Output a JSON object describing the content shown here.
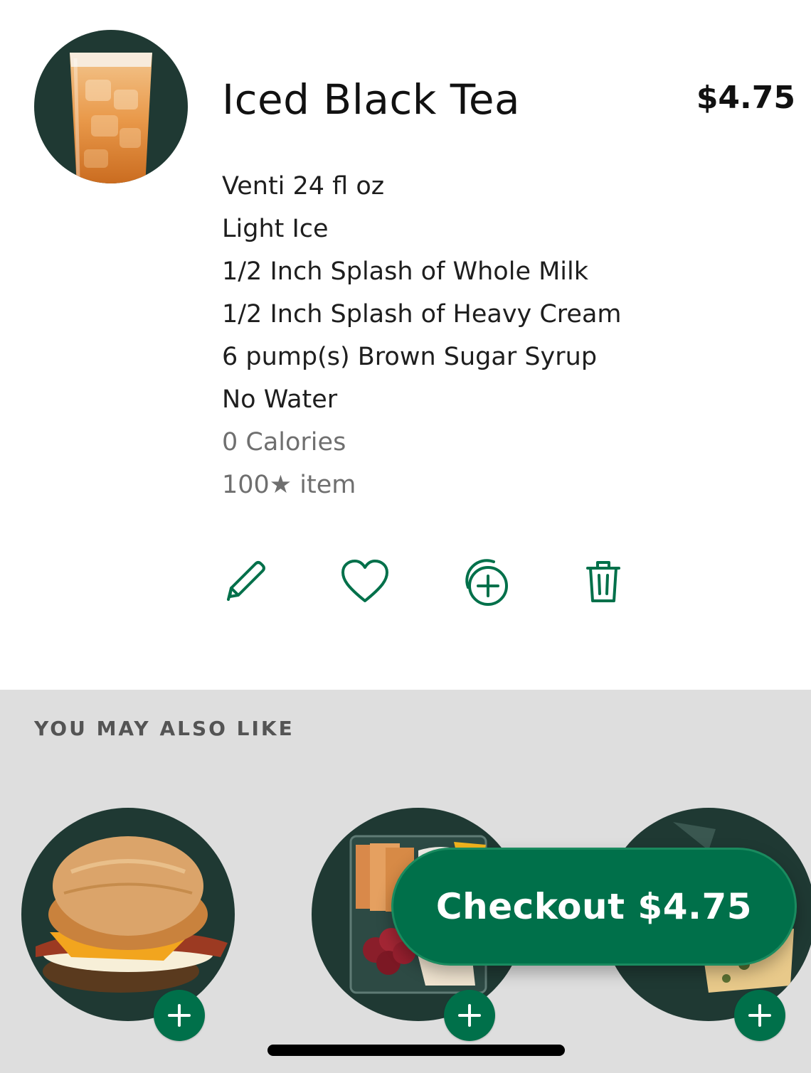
{
  "item": {
    "title": "Iced Black Tea",
    "price": "$4.75",
    "image": "iced-black-tea-cup",
    "options": [
      "Venti 24 fl oz",
      "Light Ice",
      "1/2 Inch Splash of Whole Milk",
      "1/2 Inch Splash of Heavy Cream",
      "6 pump(s) Brown Sugar Syrup",
      "No Water"
    ],
    "calories": "0 Calories",
    "stars": "100★ item"
  },
  "actions": {
    "edit_icon": "pencil-icon",
    "favorite_icon": "heart-icon",
    "duplicate_icon": "add-copy-icon",
    "delete_icon": "trash-icon"
  },
  "recommendations": {
    "heading": "YOU MAY ALSO LIKE",
    "items": [
      {
        "image": "breakfast-sandwich"
      },
      {
        "image": "snack-protein-box"
      },
      {
        "image": "egg-bites"
      }
    ]
  },
  "checkout": {
    "label": "Checkout $4.75"
  },
  "colors": {
    "brand_green": "#00704a",
    "house_green": "#1f3933",
    "section_bg": "#dedede"
  }
}
